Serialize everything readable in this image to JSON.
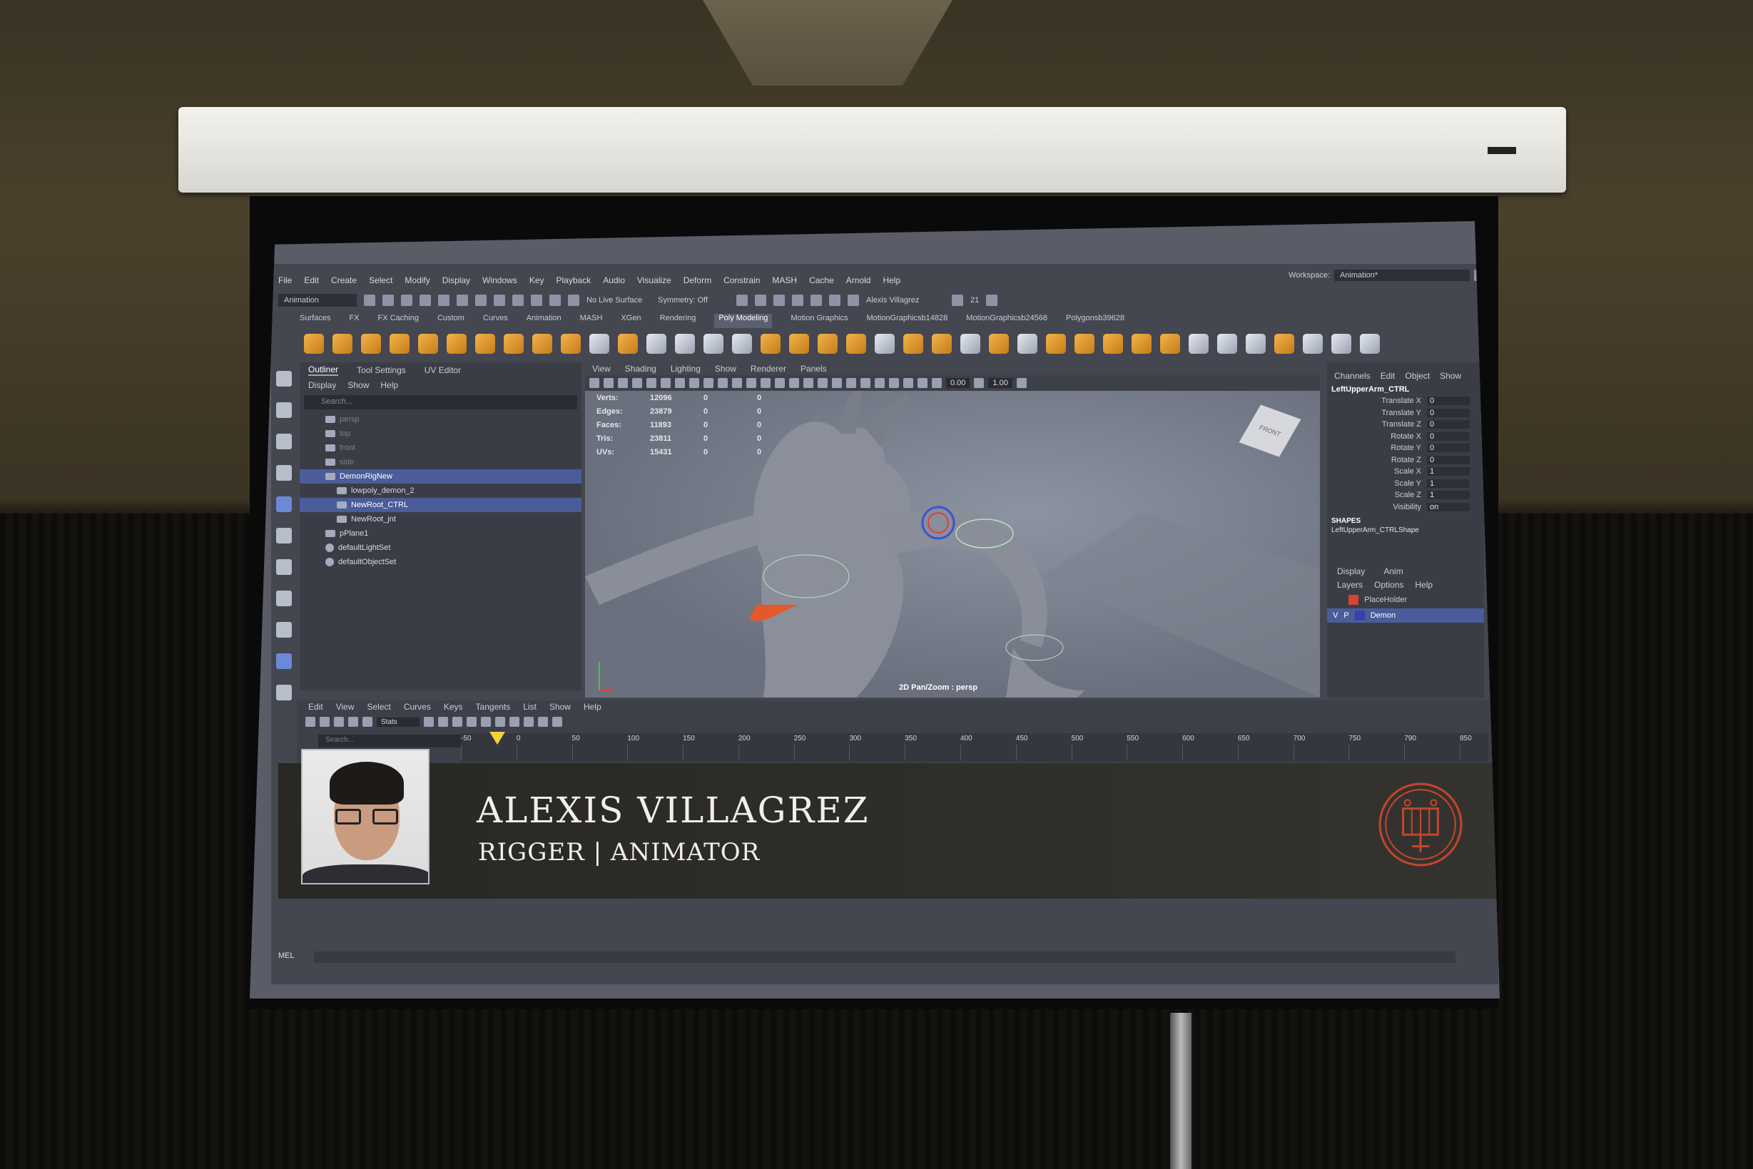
{
  "menubar": [
    "File",
    "Edit",
    "Create",
    "Select",
    "Modify",
    "Display",
    "Windows",
    "Key",
    "Playback",
    "Audio",
    "Visualize",
    "Deform",
    "Constrain",
    "MASH",
    "Cache",
    "Arnold",
    "Help"
  ],
  "workspace": {
    "label": "Workspace:",
    "value": "Animation*"
  },
  "status_line": {
    "menu_set": "Animation",
    "live_surface": "No Live Surface",
    "symmetry": "Symmetry: Off",
    "user": "Alexis Villagrez",
    "clock": "21"
  },
  "shelf_tabs": [
    "Surfaces",
    "FX",
    "FX Caching",
    "Custom",
    "Curves",
    "Animation",
    "MASH",
    "XGen",
    "Rendering",
    "Poly Modeling",
    "Motion Graphics",
    "MotionGraphicsb14828",
    "MotionGraphicsb24568",
    "Polygonsb39628"
  ],
  "shelf_active": "Poly Modeling",
  "outliner": {
    "tabs": [
      "Outliner",
      "Tool Settings",
      "UV Editor"
    ],
    "menu": [
      "Display",
      "Show",
      "Help"
    ],
    "search_placeholder": "Search...",
    "items": [
      {
        "label": "persp",
        "dim": true
      },
      {
        "label": "top",
        "dim": true
      },
      {
        "label": "front",
        "dim": true
      },
      {
        "label": "side",
        "dim": true
      },
      {
        "label": "DemonRigNew",
        "sel": true
      },
      {
        "label": "lowpoly_demon_2"
      },
      {
        "label": "NewRoot_CTRL",
        "sel": true
      },
      {
        "label": "NewRoot_jnt"
      },
      {
        "label": "pPlane1"
      },
      {
        "label": "defaultLightSet"
      },
      {
        "label": "defaultObjectSet"
      }
    ]
  },
  "viewport": {
    "menu": [
      "View",
      "Shading",
      "Lighting",
      "Show",
      "Renderer",
      "Panels"
    ],
    "field1": "0.00",
    "field2": "1.00",
    "hud": [
      {
        "k": "Verts:",
        "v": "12096",
        "a": "0",
        "b": "0"
      },
      {
        "k": "Edges:",
        "v": "23879",
        "a": "0",
        "b": "0"
      },
      {
        "k": "Faces:",
        "v": "11893",
        "a": "0",
        "b": "0"
      },
      {
        "k": "Tris:",
        "v": "23811",
        "a": "0",
        "b": "0"
      },
      {
        "k": "UVs:",
        "v": "15431",
        "a": "0",
        "b": "0"
      }
    ],
    "viewcube_label": "FRONT",
    "camera_label": "2D Pan/Zoom : persp"
  },
  "channel_box": {
    "menu": [
      "Channels",
      "Edit",
      "Object",
      "Show"
    ],
    "object": "LeftUpperArm_CTRL",
    "channels": [
      {
        "k": "Translate X",
        "v": "0"
      },
      {
        "k": "Translate Y",
        "v": "0"
      },
      {
        "k": "Translate Z",
        "v": "0"
      },
      {
        "k": "Rotate X",
        "v": "0"
      },
      {
        "k": "Rotate Y",
        "v": "0"
      },
      {
        "k": "Rotate Z",
        "v": "0"
      },
      {
        "k": "Scale X",
        "v": "1"
      },
      {
        "k": "Scale Y",
        "v": "1"
      },
      {
        "k": "Scale Z",
        "v": "1"
      },
      {
        "k": "Visibility",
        "v": "on"
      }
    ],
    "shapes_label": "SHAPES",
    "shape": "LeftUpperArm_CTRLShape"
  },
  "layer_editor": {
    "tabs": [
      "Display",
      "Anim"
    ],
    "menu": [
      "Layers",
      "Options",
      "Help"
    ],
    "layers": [
      {
        "name": "PlaceHolder",
        "color": "#d9432f",
        "v": "",
        "p": ""
      },
      {
        "name": "Demon",
        "color": "#3a3fae",
        "v": "V",
        "p": "P"
      }
    ]
  },
  "time_editor": {
    "menu": [
      "Edit",
      "View",
      "Select",
      "Curves",
      "Keys",
      "Tangents",
      "List",
      "Show",
      "Help"
    ],
    "stats_label": "Stats",
    "search_placeholder": "Search...",
    "ticks": [
      "-50",
      "0",
      "50",
      "100",
      "150",
      "200",
      "250",
      "300",
      "350",
      "400",
      "450",
      "500",
      "550",
      "600",
      "650",
      "700",
      "750",
      "790",
      "850"
    ]
  },
  "command_line_label": "MEL",
  "lower_third": {
    "name": "ALEXIS VILLAGREZ",
    "role": "RIGGER | ANIMATOR"
  }
}
